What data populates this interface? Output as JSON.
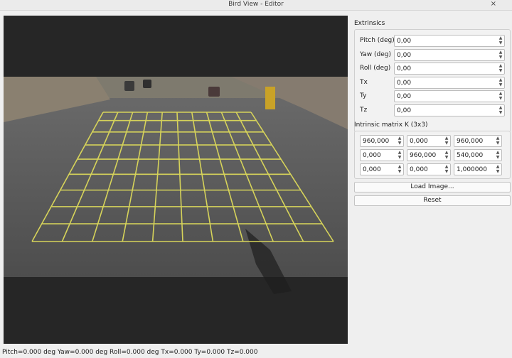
{
  "window": {
    "title": "Bird View - Editor",
    "close_glyph": "×"
  },
  "extrinsics": {
    "title": "Extrinsics",
    "rows": [
      {
        "label": "Pitch (deg)",
        "value": "0,00"
      },
      {
        "label": "Yaw   (deg)",
        "value": "0,00"
      },
      {
        "label": "Roll  (deg)",
        "value": "0,00"
      },
      {
        "label": "Tx",
        "value": "0,00"
      },
      {
        "label": "Ty",
        "value": "0,00"
      },
      {
        "label": "Tz",
        "value": "0,00"
      }
    ]
  },
  "intrinsics": {
    "title": "Intrinsic matrix K (3x3)",
    "matrix": [
      [
        "960,000",
        "0,000",
        "960,000"
      ],
      [
        "0,000",
        "960,000",
        "540,000"
      ],
      [
        "0,000",
        "0,000",
        "1,000000"
      ]
    ]
  },
  "buttons": {
    "load": "Load Image...",
    "reset": "Reset"
  },
  "status": "Pitch=0.000 deg  Yaw=0.000 deg  Roll=0.000 deg  Tx=0.000  Ty=0.000  Tz=0.000",
  "spin_icons": {
    "up": "▲",
    "down": "▼"
  },
  "colors": {
    "grid_line": "#d6d35a",
    "road": "#575757",
    "background": "#262626"
  }
}
